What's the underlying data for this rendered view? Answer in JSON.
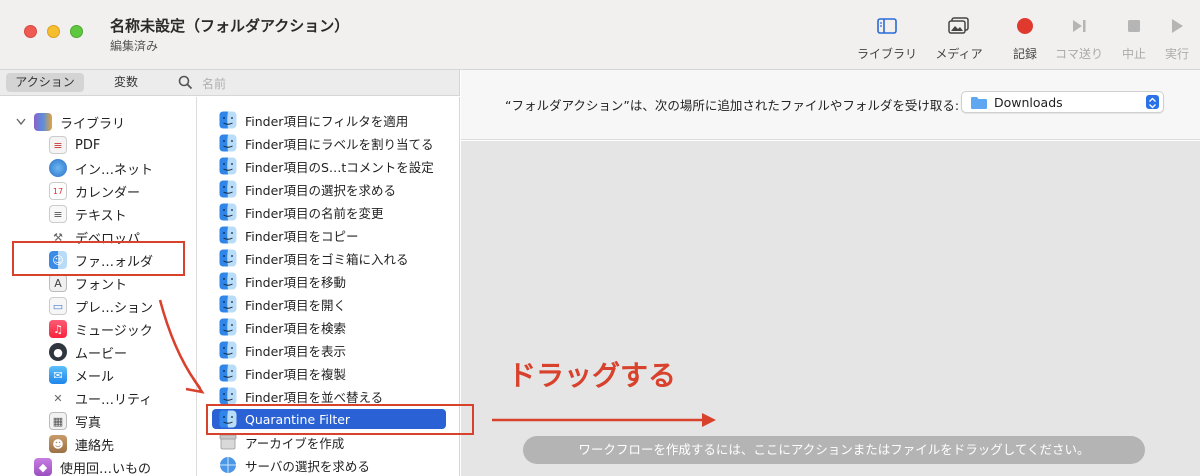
{
  "window": {
    "title": "名称未設定（フォルダアクション）",
    "subtitle": "編集済み"
  },
  "toolbar": {
    "library": "ライブラリ",
    "media": "メディア",
    "record": "記録",
    "step": "コマ送り",
    "stop": "中止",
    "run": "実行",
    "record_color": "#e03a2f"
  },
  "left_bar": {
    "actions_tab": "アクション",
    "variables_tab": "変数",
    "search_placeholder": "名前"
  },
  "library": {
    "items": [
      {
        "label": "ライブラリ",
        "icon": "library-books-icon"
      },
      {
        "label": "PDF",
        "icon": "pdf-icon"
      },
      {
        "label": "イン…ネット",
        "icon": "globe-icon"
      },
      {
        "label": "カレンダー",
        "icon": "calendar-icon"
      },
      {
        "label": "テキスト",
        "icon": "text-icon"
      },
      {
        "label": "デベロッパ",
        "icon": "developer-icon"
      },
      {
        "label": "ファ…ォルダ",
        "icon": "finder-icon"
      },
      {
        "label": "フォント",
        "icon": "font-icon"
      },
      {
        "label": "プレ…ション",
        "icon": "presentation-icon"
      },
      {
        "label": "ミュージック",
        "icon": "music-icon"
      },
      {
        "label": "ムービー",
        "icon": "movie-icon"
      },
      {
        "label": "メール",
        "icon": "mail-icon"
      },
      {
        "label": "ユー…リティ",
        "icon": "utilities-icon"
      },
      {
        "label": "写真",
        "icon": "photos-icon"
      },
      {
        "label": "連絡先",
        "icon": "contacts-icon"
      },
      {
        "label": "使用回…いもの",
        "icon": "most-used-icon"
      }
    ]
  },
  "actions": {
    "items": [
      "Finder項目にフィルタを適用",
      "Finder項目にラベルを割り当てる",
      "Finder項目のS…tコメントを設定",
      "Finder項目の選択を求める",
      "Finder項目の名前を変更",
      "Finder項目をコピー",
      "Finder項目をゴミ箱に入れる",
      "Finder項目を移動",
      "Finder項目を開く",
      "Finder項目を検索",
      "Finder項目を表示",
      "Finder項目を複製",
      "Finder項目を並べ替える",
      "Quarantine Filter",
      "アーカイブを作成",
      "サーバの選択を求める"
    ],
    "selected_index": 13
  },
  "workflow": {
    "receives_label": "“フォルダアクション”は、次の場所に追加されたファイルやフォルダを受け取る:",
    "folder_value": "Downloads",
    "hint": "ワークフローを作成するには、ここにアクションまたはファイルをドラッグしてください。"
  },
  "annotation": {
    "drag_text": "ドラッグする",
    "color": "#d8412c"
  }
}
